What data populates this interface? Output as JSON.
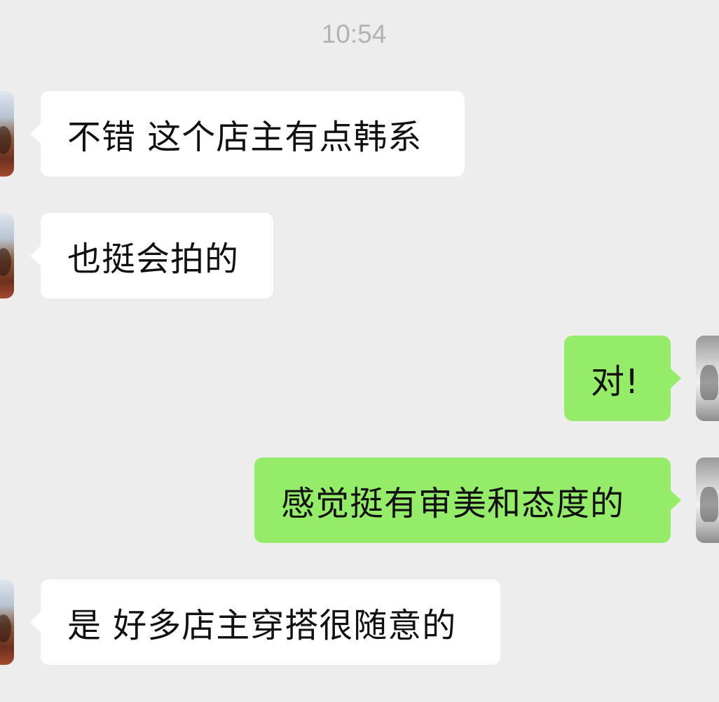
{
  "chat": {
    "timestamp": "10:54",
    "messages": [
      {
        "side": "left",
        "text": "不错 这个店主有点韩系",
        "avatar_icon": "contact-avatar-icon"
      },
      {
        "side": "left",
        "text": "也挺会拍的",
        "avatar_icon": "contact-avatar-icon"
      },
      {
        "side": "right",
        "text": "对!",
        "avatar_icon": "self-avatar-icon"
      },
      {
        "side": "right",
        "text": "感觉挺有审美和态度的",
        "avatar_icon": "self-avatar-icon"
      },
      {
        "side": "left",
        "text": "是 好多店主穿搭很随意的",
        "avatar_icon": "contact-avatar-icon"
      }
    ]
  },
  "colors": {
    "background": "#ededed",
    "incoming_bubble": "#ffffff",
    "outgoing_bubble": "#95ec69",
    "timestamp_text": "#b2b2b2",
    "message_text": "#111111"
  }
}
